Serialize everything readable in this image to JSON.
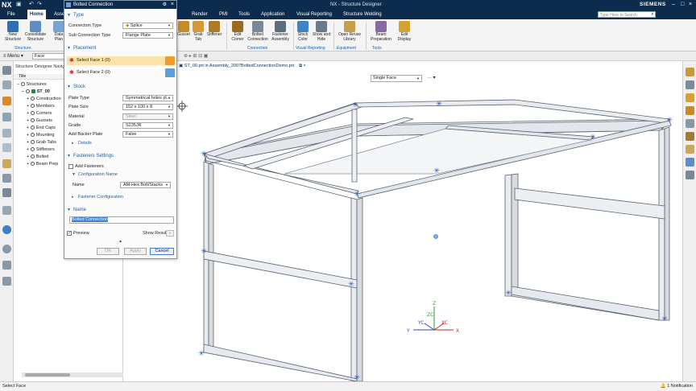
{
  "app": {
    "logo": "NX",
    "title": "NX - Structure Designer",
    "brand": "SIEMENS",
    "search_placeholder": "Type Here to Search"
  },
  "menu_tabs": [
    "File",
    "Home",
    "Assembly",
    "Render",
    "PMI",
    "Tools",
    "Application",
    "Visual Reporting",
    "Structure Welding"
  ],
  "ribbon": {
    "buttons": [
      {
        "label": "New Structure",
        "color": "#2f6db5"
      },
      {
        "label": "Consolidate Structure",
        "color": "#5c8ec4"
      },
      {
        "label": "Data Plan",
        "color": "#7aa3cf"
      },
      {
        "label": "Gusset",
        "color": "#c58a2a"
      },
      {
        "label": "Grab Tab",
        "color": "#d49a3a"
      },
      {
        "label": "Stiffener",
        "color": "#b07a22"
      },
      {
        "label": "Edit Corner",
        "color": "#9c6a1e"
      },
      {
        "label": "Bolted Connection",
        "color": "#7a8794"
      },
      {
        "label": "Fastener Assembly",
        "color": "#5e6d7c"
      },
      {
        "label": "Stock Color",
        "color": "#3d84c6"
      },
      {
        "label": "Show and Hide",
        "color": "#6b7b8c"
      },
      {
        "label": "Open Reuse Library",
        "color": "#c4a04a"
      },
      {
        "label": "Beam Preparation",
        "color": "#8a6a9e"
      },
      {
        "label": "Edit Display",
        "color": "#d4a132"
      }
    ],
    "groups": [
      "Structure",
      "Connection",
      "Visual Reporting",
      "Equipment",
      "Tools"
    ]
  },
  "selection_bar": {
    "menu_label": "Menu",
    "filter_value": "Face"
  },
  "navigator": {
    "title": "Structure Designer Navigator",
    "column_header": "Title",
    "rows": [
      {
        "label": "Structures",
        "indent": 0
      },
      {
        "label": "ST_00",
        "indent": 1
      },
      {
        "label": "Construction",
        "indent": 2
      },
      {
        "label": "Members",
        "indent": 2
      },
      {
        "label": "Corners",
        "indent": 2
      },
      {
        "label": "Gussets",
        "indent": 2
      },
      {
        "label": "End Caps",
        "indent": 2
      },
      {
        "label": "Mounting",
        "indent": 2
      },
      {
        "label": "Grab Tabs",
        "indent": 2
      },
      {
        "label": "Stiffeners",
        "indent": 2
      },
      {
        "label": "Bolted",
        "indent": 2
      },
      {
        "label": "Beam Prep",
        "indent": 2
      }
    ]
  },
  "dialog": {
    "title": "Bolted Connection",
    "sections": {
      "type": "Type",
      "placement": "Placement",
      "stock": "Stock",
      "details": "Details",
      "fasteners_settings": "Fasteners Settings",
      "configuration_name": "Configuration Name",
      "fastener_configuration": "Fastener Configuration",
      "name": "Name"
    },
    "connection_type_label": "Connection Type",
    "connection_type_value": "Splice",
    "sub_connection_type_label": "Sub Connection Type",
    "sub_connection_type_value": "Flange Plate",
    "select_face_1": "Select Face 1 (0)",
    "select_face_2": "Select Face 2 (0)",
    "plate_type_label": "Plate Type",
    "plate_type_value": "Symmetrical holes pl...",
    "plate_size_label": "Plate Size",
    "plate_size_value": "152 x 100 x 8",
    "material_label": "Material",
    "material_value": "Steel",
    "grade_label": "Grade",
    "grade_value": "S235JR",
    "backer_label": "Add Backer Plate",
    "backer_value": "False",
    "add_fasteners_label": "Add Fasteners",
    "config_name_label": "Name",
    "config_name_value": "AM-Hex Bolt/Stacks",
    "name_value": "Bolted Connection",
    "preview_label": "Preview",
    "show_result_label": "Show Result",
    "ok_label": "OK",
    "apply_label": "Apply",
    "cancel_label": "Cancel"
  },
  "viewport": {
    "tab_label": "ST_00.prt in Assembly_2007BoltedConnectionDemo.prt",
    "filter_value": "Single Face",
    "triad": {
      "x": "X",
      "y": "Y",
      "z": "Z",
      "zc": "ZC",
      "xc": "XC",
      "yc": "YC"
    }
  },
  "status": {
    "text": "Select Face",
    "notification": "1 Notification"
  },
  "colors": {
    "title_bar": "#0d2c4d",
    "accent": "#1a5fa8",
    "required": "#d42020",
    "select_orange": "#f39a2c"
  }
}
